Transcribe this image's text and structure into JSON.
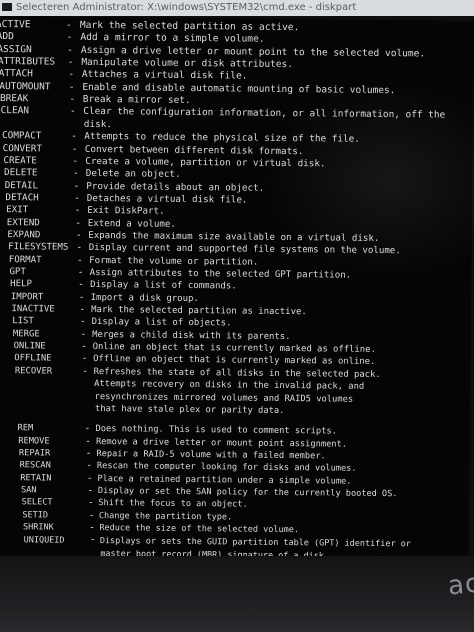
{
  "window": {
    "title": "Selecteren Administrator: X:\\windows\\SYSTEM32\\cmd.exe - diskpart"
  },
  "commands": [
    {
      "cmd": "ACTIVE",
      "desc": "Mark the selected partition as active."
    },
    {
      "cmd": "ADD",
      "desc": "Add a mirror to a simple volume."
    },
    {
      "cmd": "ASSIGN",
      "desc": "Assign a drive letter or mount point to the selected volume."
    },
    {
      "cmd": "ATTRIBUTES",
      "desc": "Manipulate volume or disk attributes."
    },
    {
      "cmd": "ATTACH",
      "desc": "Attaches a virtual disk file."
    },
    {
      "cmd": "AUTOMOUNT",
      "desc": "Enable and disable automatic mounting of basic volumes."
    },
    {
      "cmd": "BREAK",
      "desc": "Break a mirror set."
    },
    {
      "cmd": "CLEAN",
      "desc": "Clear the configuration information, or all information, off the"
    },
    {
      "cmd": "",
      "desc": "disk."
    },
    {
      "cmd": "COMPACT",
      "desc": "Attempts to reduce the physical size of the file."
    },
    {
      "cmd": "CONVERT",
      "desc": "Convert between different disk formats."
    },
    {
      "cmd": "CREATE",
      "desc": "Create a volume, partition or virtual disk."
    },
    {
      "cmd": "DELETE",
      "desc": "Delete an object."
    },
    {
      "cmd": "DETAIL",
      "desc": "Provide details about an object."
    },
    {
      "cmd": "DETACH",
      "desc": "Detaches a virtual disk file."
    },
    {
      "cmd": "EXIT",
      "desc": "Exit DiskPart."
    },
    {
      "cmd": "EXTEND",
      "desc": "Extend a volume."
    },
    {
      "cmd": "EXPAND",
      "desc": "Expands the maximum size available on a virtual disk."
    },
    {
      "cmd": "FILESYSTEMS",
      "desc": "Display current and supported file systems on the volume."
    },
    {
      "cmd": "FORMAT",
      "desc": "Format the volume or partition."
    },
    {
      "cmd": "GPT",
      "desc": "Assign attributes to the selected GPT partition."
    },
    {
      "cmd": "HELP",
      "desc": "Display a list of commands."
    },
    {
      "cmd": "IMPORT",
      "desc": "Import a disk group."
    },
    {
      "cmd": "INACTIVE",
      "desc": "Mark the selected partition as inactive."
    },
    {
      "cmd": "LIST",
      "desc": "Display a list of objects."
    },
    {
      "cmd": "MERGE",
      "desc": "Merges a child disk with its parents."
    },
    {
      "cmd": "ONLINE",
      "desc": "Online an object that is currently marked as offline."
    },
    {
      "cmd": "OFFLINE",
      "desc": "Offline an object that is currently marked as online."
    },
    {
      "cmd": "RECOVER",
      "desc": "Refreshes the state of all disks in the selected pack."
    },
    {
      "cmd": "",
      "desc": "Attempts recovery on disks in the invalid pack, and"
    },
    {
      "cmd": "",
      "desc": "resynchronizes mirrored volumes and RAID5 volumes"
    },
    {
      "cmd": "",
      "desc": "that have stale plex or parity data."
    },
    {
      "cmd": "REM",
      "desc": "Does nothing. This is used to comment scripts."
    },
    {
      "cmd": "REMOVE",
      "desc": "Remove a drive letter or mount point assignment."
    },
    {
      "cmd": "REPAIR",
      "desc": "Repair a RAID-5 volume with a failed member."
    },
    {
      "cmd": "RESCAN",
      "desc": "Rescan the computer looking for disks and volumes."
    },
    {
      "cmd": "RETAIN",
      "desc": "Place a retained partition under a simple volume."
    },
    {
      "cmd": "SAN",
      "desc": "Display or set the SAN policy for the currently booted OS."
    },
    {
      "cmd": "SELECT",
      "desc": "Shift the focus to an object."
    },
    {
      "cmd": "SETID",
      "desc": "Change the partition type."
    },
    {
      "cmd": "SHRINK",
      "desc": "Reduce the size of the selected volume."
    },
    {
      "cmd": "UNIQUEID",
      "desc": "Displays or sets the GUID partition table (GPT) identifier or"
    },
    {
      "cmd": "",
      "desc": "master boot record (MBR) signature of a disk."
    }
  ],
  "dash_glyph": "-",
  "laptop": {
    "brand": "ac"
  }
}
